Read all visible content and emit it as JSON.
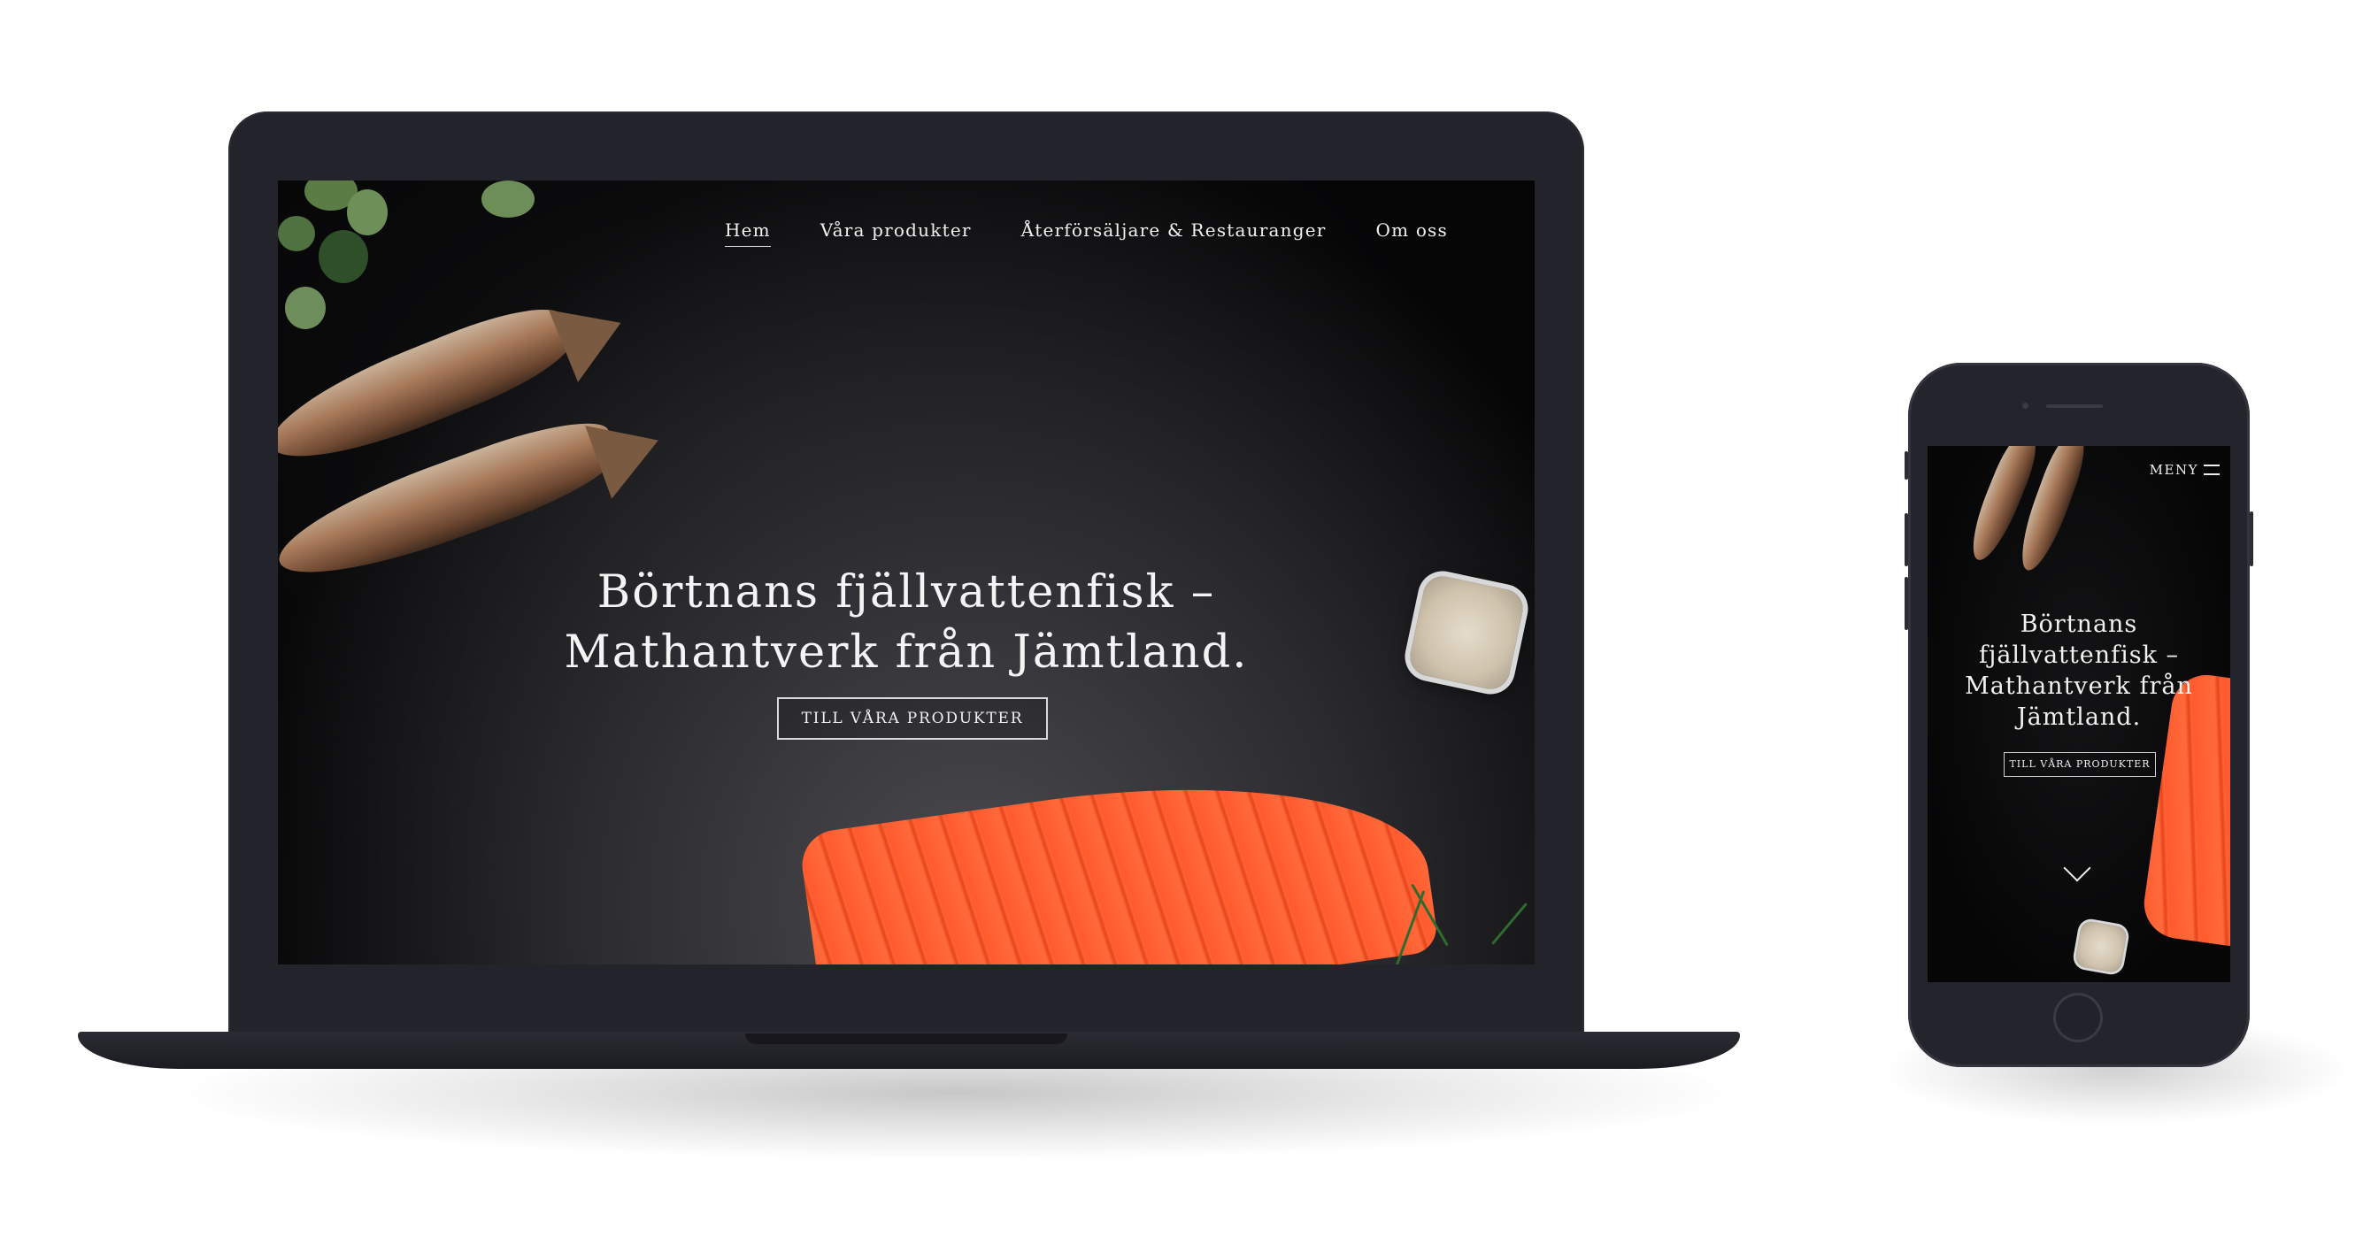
{
  "desktop": {
    "nav": {
      "items": [
        {
          "label": "Hem",
          "active": true
        },
        {
          "label": "Våra produkter",
          "active": false
        },
        {
          "label": "Återförsäljare & Restauranger",
          "active": false
        },
        {
          "label": "Om oss",
          "active": false
        }
      ]
    },
    "hero": {
      "title_line1": "Börtnans fjällvattenfisk –",
      "title_line2": "Mathantverk från Jämtland.",
      "cta_label": "TILL VÅRA PRODUKTER"
    }
  },
  "mobile": {
    "menu_label": "MENY",
    "menu_icon": "hamburger-icon",
    "hero": {
      "title_lines": [
        "Börtnans",
        "fjällvattenfisk –",
        "Mathantverk från",
        "Jämtland."
      ],
      "cta_label": "TILL VÅRA PRODUKTER",
      "scroll_icon": "chevron-down-icon"
    }
  },
  "colors": {
    "device_frame": "#23232b",
    "hero_background": "#050506",
    "salmon": "#ff5a2e",
    "text": "#f4f4f4"
  }
}
